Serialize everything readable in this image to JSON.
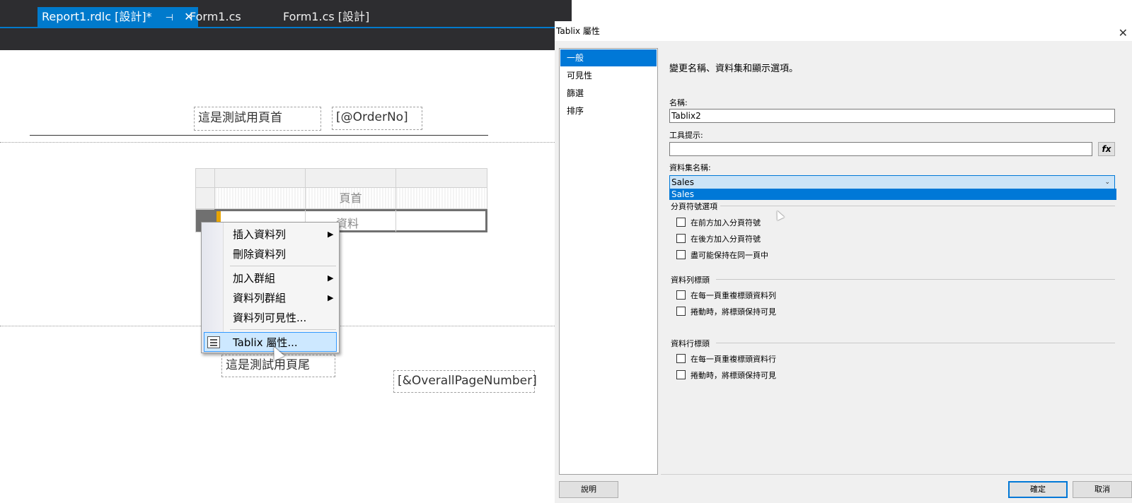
{
  "tabs": [
    {
      "label": "Report1.rdlc [設計]*",
      "pin": "⊣",
      "close": "✕"
    },
    {
      "label": "Form1.cs"
    },
    {
      "label": "Form1.cs [設計]"
    }
  ],
  "report": {
    "header_text": "這是測試用頁首",
    "header_field": "[@OrderNo]",
    "tablix_header_cell": "頁首",
    "tablix_data_cell": "資料",
    "footer_text": "這是測試用頁尾",
    "footer_field": "[&OverallPageNumber]"
  },
  "context_menu": {
    "items": [
      {
        "label": "插入資料列",
        "submenu": true
      },
      {
        "label": "刪除資料列",
        "submenu": false
      },
      {
        "label": "加入群組",
        "submenu": true
      },
      {
        "label": "資料列群組",
        "submenu": true
      },
      {
        "label": "資料列可見性...",
        "submenu": false
      },
      {
        "label": "Tablix 屬性...",
        "submenu": false,
        "highlighted": true
      }
    ],
    "arrow": "▶"
  },
  "dialog": {
    "title": "Tablix 屬性",
    "close": "✕",
    "nav": [
      "一般",
      "可見性",
      "篩選",
      "排序"
    ],
    "selected_nav": "一般",
    "description": "變更名稱、資料集和顯示選項。",
    "name_label": "名稱:",
    "name_value": "Tablix2",
    "tooltip_label": "工具提示:",
    "tooltip_value": "",
    "fx_label": "fx",
    "dataset_label": "資料集名稱:",
    "dataset_value": "Sales",
    "dataset_options": [
      "Sales"
    ],
    "page_break": {
      "title": "分頁符號選項",
      "options": [
        "在前方加入分頁符號",
        "在後方加入分頁符號",
        "盡可能保持在同一頁中"
      ]
    },
    "row_headers": {
      "title": "資料列標頭",
      "options": [
        "在每一頁重複標頭資料列",
        "捲動時，將標頭保持可見"
      ]
    },
    "column_headers": {
      "title": "資料行標頭",
      "options": [
        "在每一頁重複標頭資料行",
        "捲動時，將標頭保持可見"
      ]
    },
    "help_button": "說明",
    "ok_button": "確定",
    "cancel_button": "取消"
  },
  "colors": {
    "accent": "#007acc",
    "selection": "#0078d7",
    "menu_highlight": "#cde8ff"
  }
}
